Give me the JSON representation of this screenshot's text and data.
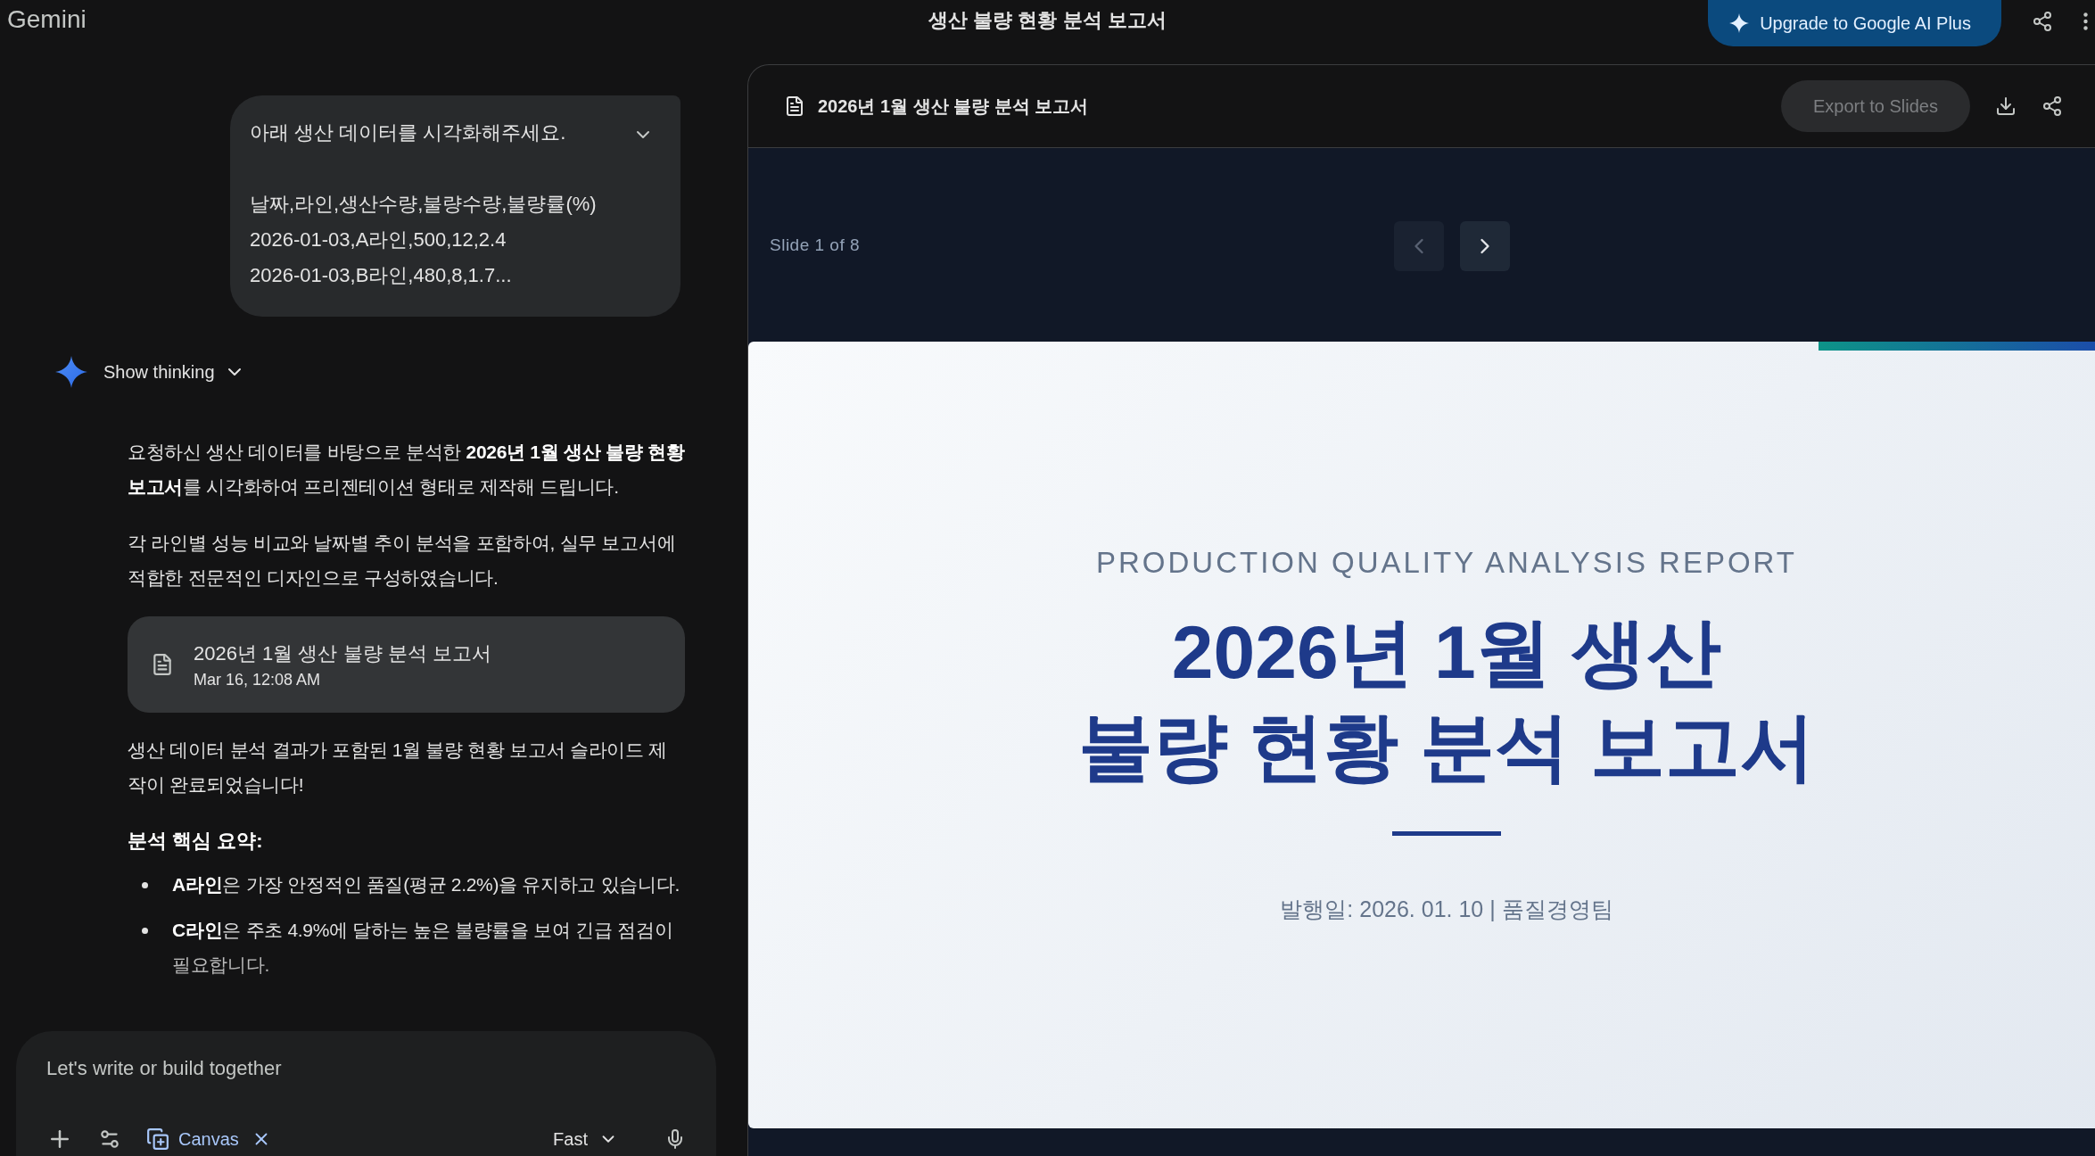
{
  "app": {
    "name": "Gemini"
  },
  "header": {
    "title": "생산 불량 현황 분석 보고서",
    "upgrade_button": "Upgrade to Google AI Plus"
  },
  "chat": {
    "user_message": {
      "lines": [
        "아래 생산 데이터를 시각화해주세요.",
        "날짜,라인,생산수량,불량수량,불량률(%)",
        "2026-01-03,A라인,500,12,2.4",
        "2026-01-03,B라인,480,8,1.7..."
      ]
    },
    "show_thinking": "Show thinking",
    "response": {
      "paragraphs": [
        "요청하신 생산 데이터를 바탕으로 분석한 **2026년 1월 생산 불량 현황 보고서**를 시각화하여 프리젠테이션 형태로 제작해 드립니다.",
        "각 라인별 성능 비교와 날짜별 추이 분석을 포함하여, 실무 보고서에 적합한 전문적인 디자인으로 구성하였습니다."
      ],
      "artifact": {
        "title": "2026년 1월 생산 불량 분석 보고서",
        "date": "Mar 16, 12:08 AM"
      },
      "closing": "생산 데이터 분석 결과가 포함된 1월 불량 현황 보고서 슬라이드 제작이 완료되었습니다!",
      "summary_heading": "분석 핵심 요약:",
      "bullets": [
        "**A라인**은 가장 안정적인 품질(평균 2.2%)을 유지하고 있습니다.",
        "**C라인**은 주초 4.9%에 달하는 높은 불량률을 보여 긴급 점검이 필요합니다."
      ]
    }
  },
  "composer": {
    "placeholder": "Let's write or build together",
    "tool": "Canvas",
    "mode": "Fast"
  },
  "canvas": {
    "title": "2026년 1월 생산 불량 분석 보고서",
    "export_button": "Export to Slides",
    "slide_counter": "Slide 1 of 8",
    "nav_buttons": [
      {
        "kind": "prev",
        "disabled": true
      },
      {
        "kind": "next",
        "disabled": false
      }
    ],
    "slide": {
      "subtitle": "PRODUCTION QUALITY ANALYSIS REPORT",
      "title_lines": [
        "2026년 1월 생산",
        "불량 현황 분석 보고서"
      ],
      "byline": "발행일: 2026. 01. 10 | 품질경영팀"
    }
  }
}
